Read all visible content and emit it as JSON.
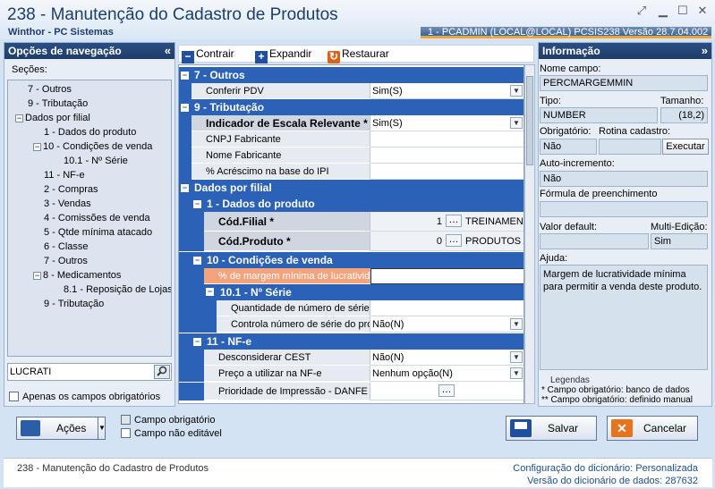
{
  "window": {
    "title": "238 - Manutenção do Cadastro de Produtos",
    "subtitle": "Winthor - PC Sistemas",
    "user_info": "1 - PCADMIN (LOCAL@LOCAL)   PCSIS238  Versão  28.7.04.002"
  },
  "nav": {
    "header": "Opções de navegação",
    "sections_label": "Seções:",
    "items": [
      {
        "label": "7 - Outros"
      },
      {
        "label": "9 - Tributação"
      },
      {
        "label": "Dados por filial"
      },
      {
        "label": "1 - Dados do produto"
      },
      {
        "label": "10 - Condições de venda"
      },
      {
        "label": "10.1 - Nº Série"
      },
      {
        "label": "11 - NF-e"
      },
      {
        "label": "2 - Compras"
      },
      {
        "label": "3 - Vendas"
      },
      {
        "label": "4 - Comissões de venda"
      },
      {
        "label": "5 - Qtde mínima atacado"
      },
      {
        "label": "6 - Classe"
      },
      {
        "label": "7 - Outros"
      },
      {
        "label": "8 - Medicamentos"
      },
      {
        "label": "8.1 - Reposição de Lojas"
      },
      {
        "label": "9 - Tributação"
      }
    ],
    "search_value": "LUCRATI",
    "only_required_label": "Apenas os campos obrigatórios"
  },
  "toolbar": {
    "collapse_label": "Contrair",
    "expand_label": "Expandir",
    "restore_label": "Restaurar"
  },
  "grid": {
    "rows": [
      {
        "type": "cat",
        "label": "7 - Outros"
      },
      {
        "type": "field",
        "label": "Conferir PDV",
        "value": "Sim(S)",
        "dropdown": true
      },
      {
        "type": "cat",
        "label": "9 - Tributação"
      },
      {
        "type": "field",
        "label": "Indicador de Escala Relevante *",
        "value": "Sim(S)",
        "dropdown": true,
        "bold": true
      },
      {
        "type": "field",
        "label": "CNPJ Fabricante",
        "value": ""
      },
      {
        "type": "field",
        "label": "Nome Fabricante",
        "value": ""
      },
      {
        "type": "field",
        "label": "% Acréscimo na base do IPI",
        "value": ""
      },
      {
        "type": "cat",
        "label": "Dados por filial"
      },
      {
        "type": "sub",
        "label": "1 - Dados do produto"
      },
      {
        "type": "keyfield",
        "label": "Cód.Filial *",
        "value": "1",
        "desc": "TREINAMENT"
      },
      {
        "type": "keyfield",
        "label": "Cód.Produto *",
        "value": "0",
        "desc": "PRODUTOS A"
      },
      {
        "type": "sub",
        "label": "10 - Condições de venda"
      },
      {
        "type": "selected",
        "label": "% de margem mínima de lucratividade",
        "value": ""
      },
      {
        "type": "sub2",
        "label": "10.1 - Nº Série"
      },
      {
        "type": "field2",
        "label": "Quantidade de número de série",
        "value": ""
      },
      {
        "type": "field2",
        "label": "Controla número de série do produto",
        "value": "Não(N)",
        "dropdown": true
      },
      {
        "type": "sub",
        "label": "11 - NF-e"
      },
      {
        "type": "field",
        "label": "Desconsiderar CEST",
        "value": "Não(N)",
        "dropdown": true
      },
      {
        "type": "field",
        "label": "Preço a utilizar na NF-e",
        "value": "Nenhum opção(N)",
        "dropdown": true
      },
      {
        "type": "fielddots",
        "label": "Prioridade de Impressão - DANFE",
        "value": ""
      }
    ]
  },
  "info": {
    "header": "Informação",
    "field_name_label": "Nome campo:",
    "field_name": "PERCMARGEMMIN",
    "type_label": "Tipo:",
    "type": "NUMBER",
    "size_label": "Tamanho:",
    "size": "(18,2)",
    "required_label": "Obrigatório:",
    "routine_label": "Rotina cadastro:",
    "required": "Não",
    "execute_label": "Executar",
    "autoinc_label": "Auto-incremento:",
    "autoinc": "Não",
    "formula_label": "Fórmula de preenchimento",
    "default_label": "Valor default:",
    "multiedit_label": "Multi-Edição:",
    "multiedit": "Sim",
    "help_label": "Ajuda:",
    "help_text": "Margem de lucratividade mínima para permitir a venda deste produto.",
    "legend_title": "Legendas",
    "legend_1": "* Campo obrigatório: banco de dados",
    "legend_2": "** Campo obrigatório: definido manual"
  },
  "footer": {
    "actions_label": "Ações",
    "required_field_label": "Campo obrigatório",
    "not_editable_label": "Campo não editável",
    "save_label": "Salvar",
    "cancel_label": "Cancelar"
  },
  "status": {
    "left": "238 - Manutenção do Cadastro de Produtos",
    "dict_config_label": "Configuração do dicionário:",
    "dict_config_value": "Personalizada",
    "dict_version_label": "Versão do dicionário de dados:",
    "dict_version_value": "287632"
  },
  "colors": {
    "accent": "#2b62b8",
    "header": "#1f3d6b",
    "selected": "#f4a37c"
  }
}
